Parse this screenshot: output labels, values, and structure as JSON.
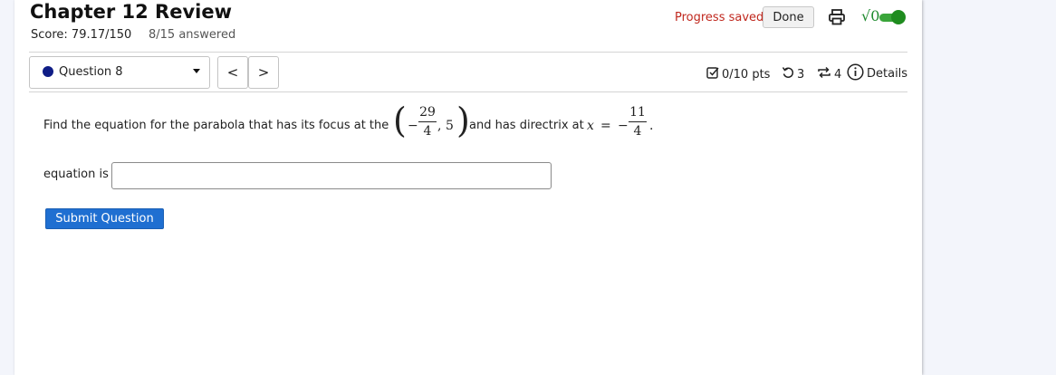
{
  "header": {
    "title": "Chapter 12 Review",
    "score": "Score: 79.17/150",
    "answered": "8/15 answered",
    "progress_status": "Progress saved",
    "done_label": "Done",
    "math_toggle_label": "√0"
  },
  "question_nav": {
    "selected": "Question 8",
    "prev_label": "<",
    "next_label": ">",
    "points": "0/10 pts",
    "tries_left": "3",
    "submissions": "4",
    "details_label": "Details"
  },
  "question": {
    "prompt_before": "Find the equation for the parabola that has its focus at the",
    "focus_x_num": "29",
    "focus_x_den": "4",
    "focus_x_sign": "−",
    "focus_y": "5",
    "prompt_after": "and has directrix at",
    "directrix_var": "x",
    "directrix_eq": "=",
    "directrix_sign": "−",
    "directrix_num": "11",
    "directrix_den": "4",
    "answer_label": "equation is",
    "answer_value": "",
    "submit_label": "Submit Question"
  },
  "colors": {
    "accent": "#1f6fd1",
    "progress_saved": "#c0281e",
    "toggle_on": "#1f8c1f",
    "question_dot": "#0f1d86"
  }
}
